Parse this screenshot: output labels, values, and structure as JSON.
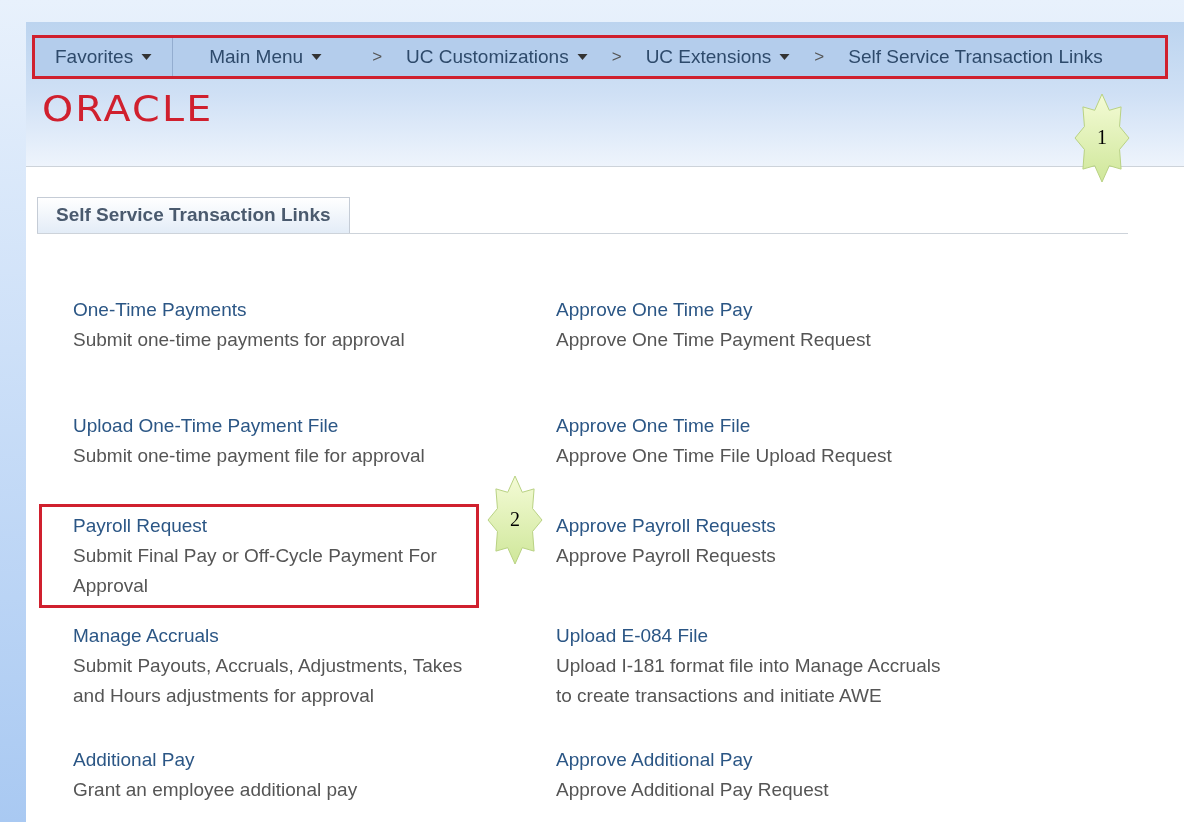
{
  "nav": {
    "items": [
      {
        "label": "Favorites",
        "dropdown": true
      },
      {
        "label": "Main Menu",
        "dropdown": true
      },
      {
        "separator": ">",
        "label": "UC Customizations",
        "dropdown": true
      },
      {
        "separator": ">",
        "label": "UC Extensions",
        "dropdown": true
      },
      {
        "separator": ">",
        "label": "Self Service Transaction Links",
        "dropdown": false
      }
    ],
    "highlighted": true
  },
  "logo": "ORACLE",
  "tabs": [
    {
      "label": "Self Service Transaction Links",
      "selected": true
    }
  ],
  "links": [
    {
      "left": {
        "title": "One-Time Payments",
        "description": "Submit one-time payments for approval",
        "highlighted": false
      },
      "right": {
        "title": "Approve One Time Pay",
        "description": "Approve One Time Payment Request"
      }
    },
    {
      "left": {
        "title": "Upload One-Time Payment File",
        "description": "Submit one-time payment file for approval",
        "highlighted": false
      },
      "right": {
        "title": "Approve One Time File",
        "description": "Approve One Time File Upload Request"
      }
    },
    {
      "left": {
        "title": "Payroll Request",
        "description": "Submit Final Pay or Off-Cycle Payment For Approval",
        "highlighted": true
      },
      "right": {
        "title": "Approve Payroll Requests",
        "description": "Approve Payroll Requests"
      }
    },
    {
      "left": {
        "title": "Manage Accruals",
        "description": "Submit Payouts, Accruals, Adjustments, Takes and Hours adjustments for approval",
        "highlighted": false
      },
      "right": {
        "title": "Upload E-084 File",
        "description": "Upload I-181 format file into Manage Accruals to create transactions and initiate AWE"
      }
    },
    {
      "left": {
        "title": "Additional Pay",
        "description": "Grant an employee additional pay",
        "highlighted": false
      },
      "right": {
        "title": "Approve Additional Pay",
        "description": "Approve Additional Pay Request"
      }
    }
  ],
  "callouts": [
    {
      "label": "1"
    },
    {
      "label": "2"
    }
  ]
}
